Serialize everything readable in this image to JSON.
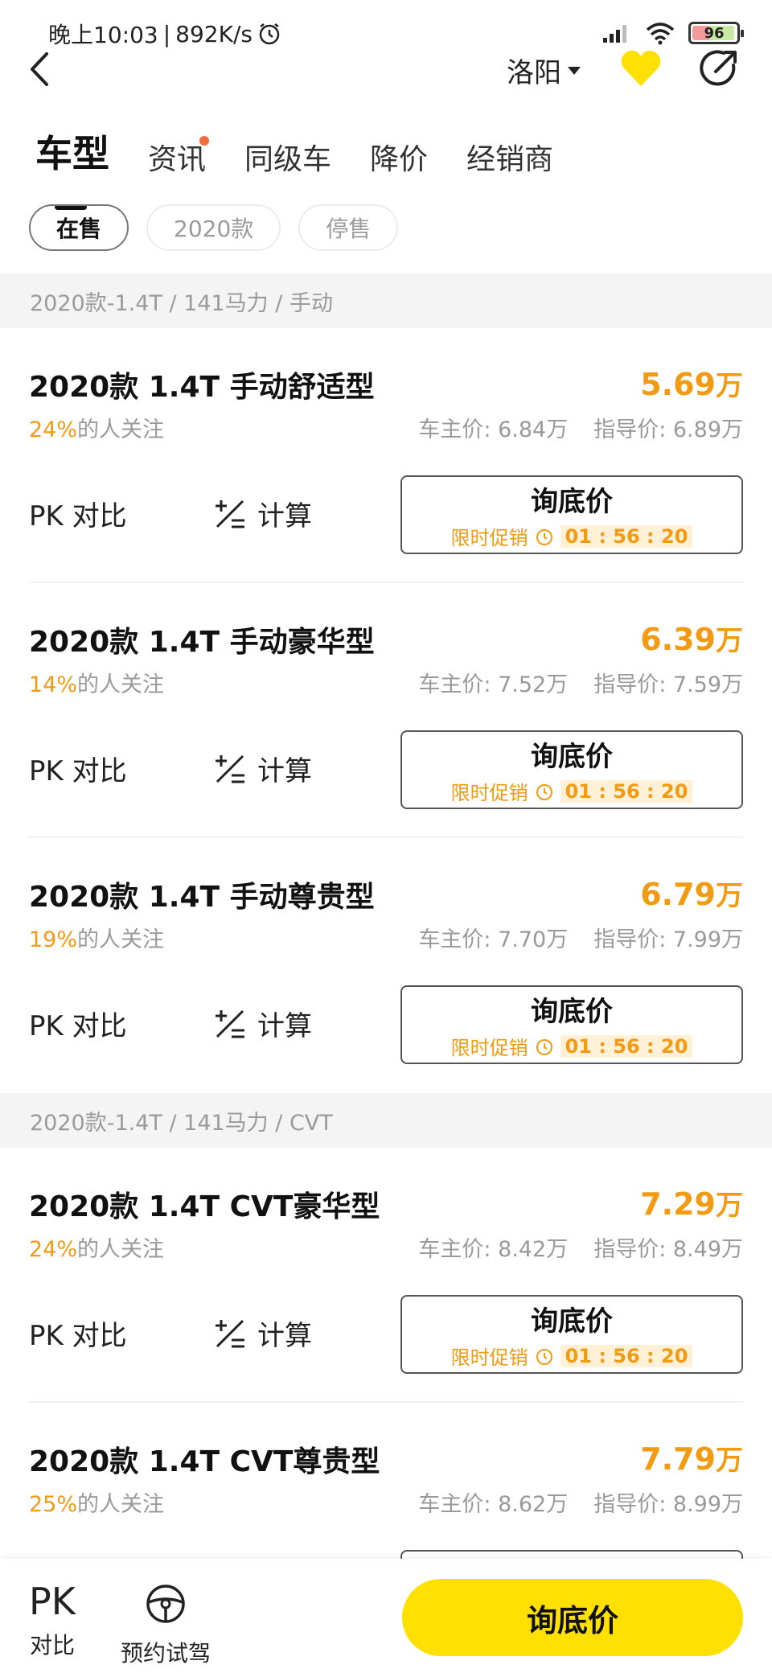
{
  "status_bar": {
    "time": "晚上10:03",
    "speed": "892K/s",
    "battery": "96"
  },
  "header": {
    "city": "洛阳"
  },
  "tabs": [
    {
      "label": "车型",
      "active": true
    },
    {
      "label": "资讯",
      "dot": true
    },
    {
      "label": "同级车"
    },
    {
      "label": "降价"
    },
    {
      "label": "经销商"
    }
  ],
  "filters": [
    {
      "label": "在售",
      "active": true
    },
    {
      "label": "2020款"
    },
    {
      "label": "停售"
    }
  ],
  "groups": [
    {
      "header": "2020款-1.4T / 141马力 / 手动",
      "items": [
        {
          "name": "2020款 1.4T 手动舒适型",
          "price": "5.69",
          "unit": "万",
          "attention_pct": "24%",
          "attention_text": "的人关注",
          "owner_price": "车主价: 6.84万",
          "guide_price": "指导价: 6.89万"
        },
        {
          "name": "2020款 1.4T 手动豪华型",
          "price": "6.39",
          "unit": "万",
          "attention_pct": "14%",
          "attention_text": "的人关注",
          "owner_price": "车主价: 7.52万",
          "guide_price": "指导价: 7.59万"
        },
        {
          "name": "2020款 1.4T 手动尊贵型",
          "price": "6.79",
          "unit": "万",
          "attention_pct": "19%",
          "attention_text": "的人关注",
          "owner_price": "车主价: 7.70万",
          "guide_price": "指导价: 7.99万"
        }
      ]
    },
    {
      "header": "2020款-1.4T / 141马力 / CVT",
      "items": [
        {
          "name": "2020款 1.4T CVT豪华型",
          "price": "7.29",
          "unit": "万",
          "attention_pct": "24%",
          "attention_text": "的人关注",
          "owner_price": "车主价: 8.42万",
          "guide_price": "指导价: 8.49万"
        },
        {
          "name": "2020款 1.4T CVT尊贵型",
          "price": "7.79",
          "unit": "万",
          "attention_pct": "25%",
          "attention_text": "的人关注",
          "owner_price": "车主价: 8.62万",
          "guide_price": "指导价: 8.99万"
        }
      ]
    }
  ],
  "item_actions": {
    "pk_label": "PK 对比",
    "calc_label": "计算",
    "inquire_label": "询底价",
    "promo_label": "限时促销",
    "countdown": "01 : 56 : 20"
  },
  "bottom_bar": {
    "pk_big": "PK",
    "pk_sub": "对比",
    "test_drive": "预约试驾",
    "cta": "询底价"
  },
  "colors": {
    "accent": "#f29a12",
    "cta_yellow": "#ffe000",
    "heart": "#ffe000"
  }
}
